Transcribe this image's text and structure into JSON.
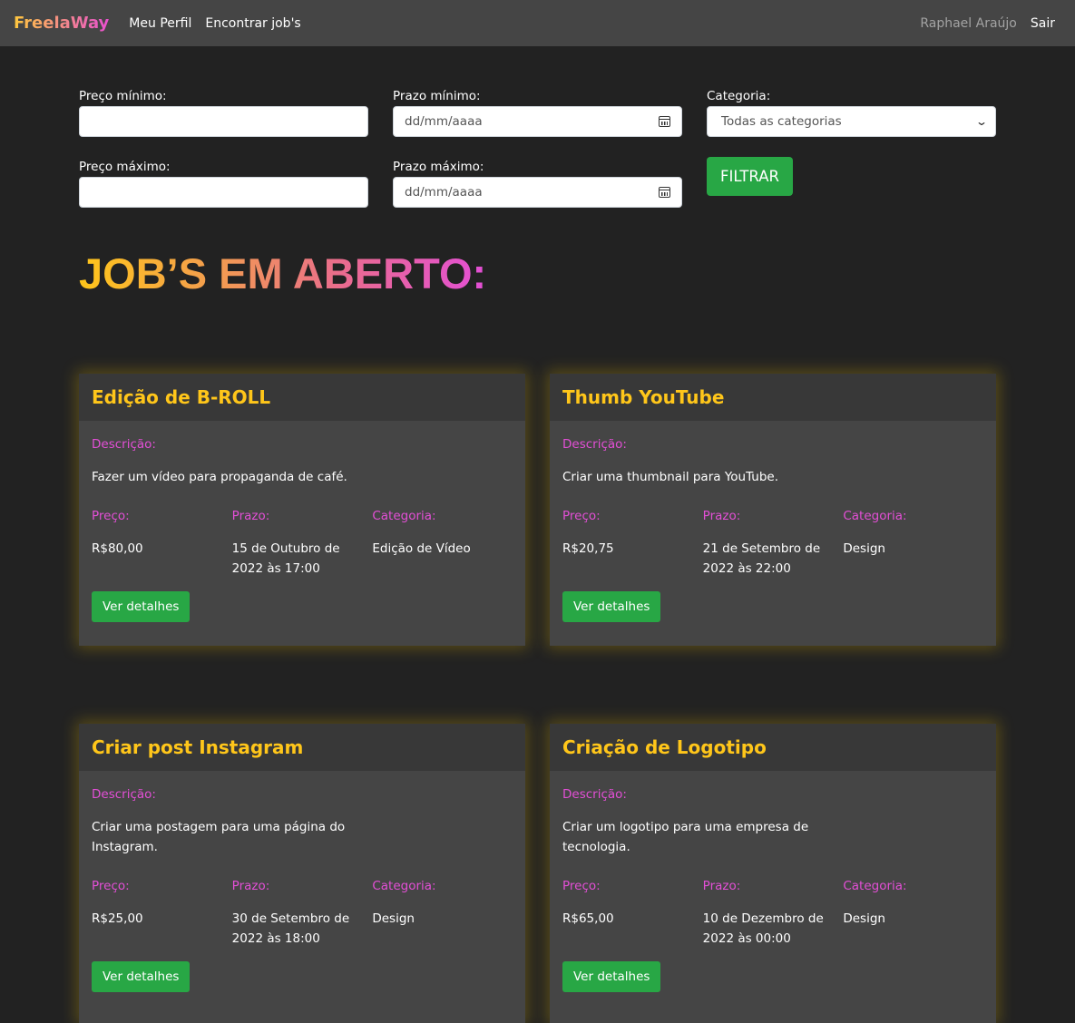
{
  "navbar": {
    "brand": "FreelaWay",
    "links": [
      "Meu Perfil",
      "Encontrar job's"
    ],
    "user": "Raphael Araújo",
    "logout": "Sair"
  },
  "filters": {
    "price_min_label": "Preço mínimo:",
    "price_max_label": "Preço máximo:",
    "deadline_min_label": "Prazo mínimo:",
    "deadline_max_label": "Prazo máximo:",
    "date_placeholder": "dd/mm/aaaa",
    "category_label": "Categoria:",
    "category_selected": "Todas as categorias",
    "filter_button": "FILTRAR"
  },
  "heading": "JOB’S EM ABERTO:",
  "labels": {
    "description": "Descrição:",
    "price": "Preço:",
    "deadline": "Prazo:",
    "category": "Categoria:",
    "details_button": "Ver detalhes"
  },
  "jobs": [
    {
      "title": "Edição de B-ROLL",
      "description": "Fazer um vídeo para propaganda de café.",
      "price": "R$80,00",
      "deadline": "15 de Outubro de 2022 às 17:00",
      "category": "Edição de Vídeo"
    },
    {
      "title": "Thumb YouTube",
      "description": "Criar uma thumbnail para YouTube.",
      "price": "R$20,75",
      "deadline": "21 de Setembro de 2022 às 22:00",
      "category": "Design"
    },
    {
      "title": "Criar post Instagram",
      "description": "Criar uma postagem para uma página do Instagram.",
      "price": "R$25,00",
      "deadline": "30 de Setembro de 2022 às 18:00",
      "category": "Design"
    },
    {
      "title": "Criação de Logotipo",
      "description": "Criar um logotipo para uma empresa de tecnologia.",
      "price": "R$65,00",
      "deadline": "10 de Dezembro de 2022 às 00:00",
      "category": "Design"
    }
  ],
  "colors": {
    "accent_yellow": "#ffc61a",
    "accent_pink": "#e34fd6",
    "button_green": "#28a745",
    "background": "#222222",
    "card": "#454545"
  }
}
